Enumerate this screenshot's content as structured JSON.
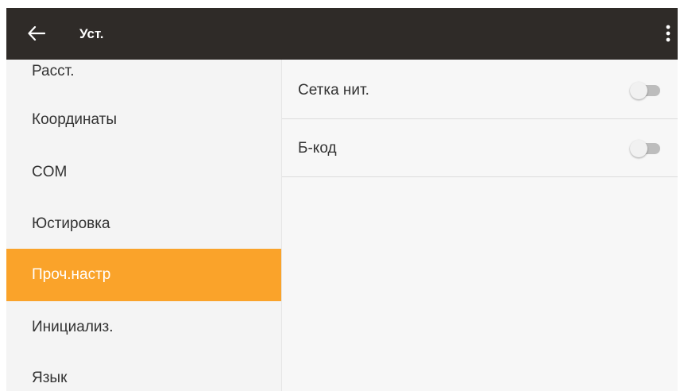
{
  "appbar": {
    "title": "Уст.",
    "back_icon": "arrow-left-icon",
    "menu_icon": "more-vert-icon",
    "background": "#2f2b28"
  },
  "sidebar": {
    "items": [
      {
        "label": "Расст.",
        "active": false
      },
      {
        "label": "Координаты",
        "active": false
      },
      {
        "label": "COM",
        "active": false
      },
      {
        "label": "Юстировка",
        "active": false
      },
      {
        "label": "Проч.настр",
        "active": true
      },
      {
        "label": "Инициализ.",
        "active": false
      },
      {
        "label": "Язык",
        "active": false
      }
    ],
    "active_color": "#faa32a"
  },
  "settings": [
    {
      "label": "Сетка нит.",
      "enabled": false
    },
    {
      "label": "Б-код",
      "enabled": false
    }
  ]
}
